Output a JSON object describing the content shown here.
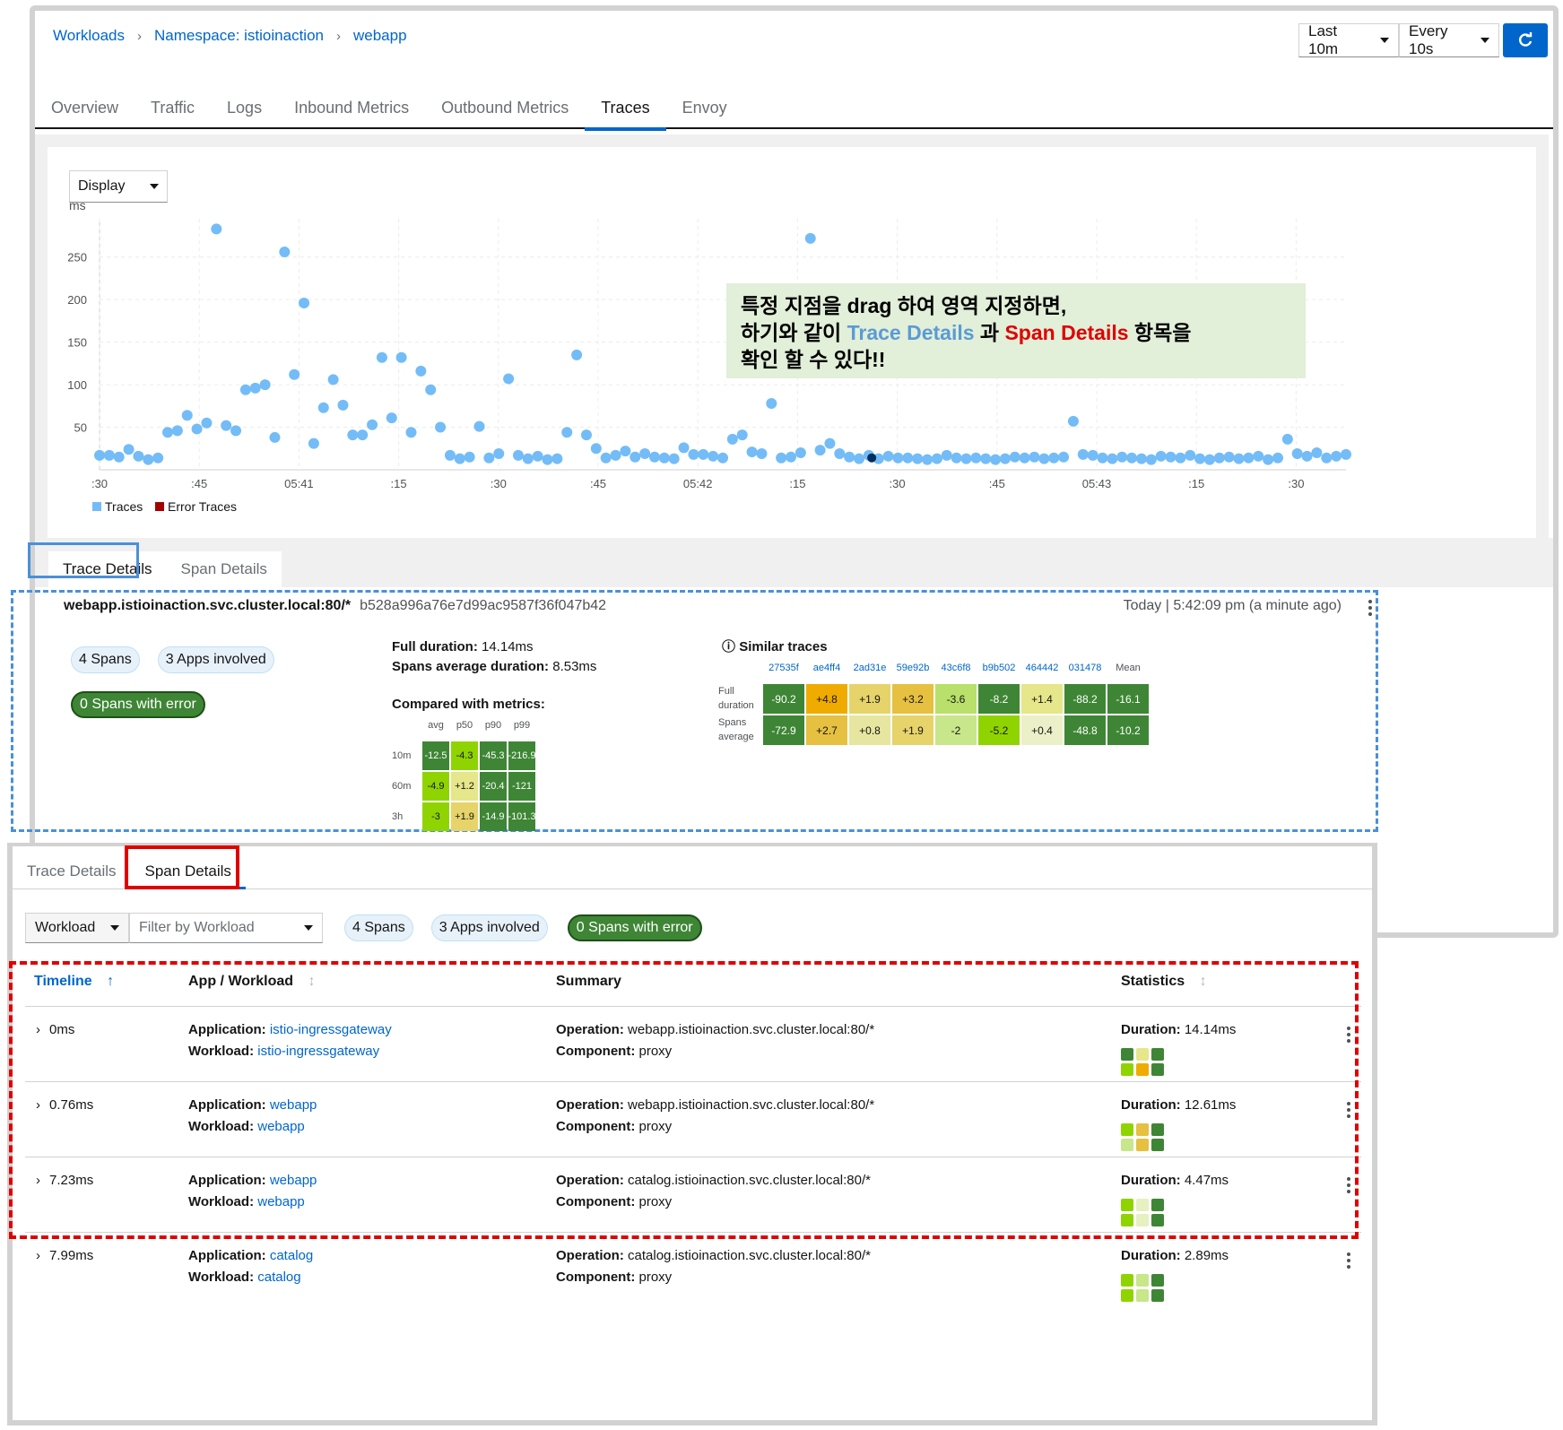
{
  "breadcrumb": [
    "Workloads",
    "Namespace: istioinaction",
    "webapp"
  ],
  "toolbar": {
    "range": "Last 10m",
    "refresh": "Every 10s"
  },
  "tabs": [
    "Overview",
    "Traffic",
    "Logs",
    "Inbound Metrics",
    "Outbound Metrics",
    "Traces",
    "Envoy"
  ],
  "active_tab": "Traces",
  "display_select": "Display",
  "annotation": {
    "line1": "특정 지점을 drag 하여 영역 지정하면,",
    "line2_a": "하기와 같이 ",
    "line2_trace": "Trace Details",
    "line2_b": " 과 ",
    "line2_span": "Span Details",
    "line2_c": " 항목을",
    "line3": "확인 할 수 있다!!"
  },
  "chart_data": {
    "type": "scatter",
    "ylabel": "ms",
    "y_ticks": [
      50,
      100,
      150,
      200,
      250
    ],
    "x_ticks": [
      ":30",
      ":45",
      "05:41",
      ":15",
      ":30",
      ":45",
      "05:42",
      ":15",
      ":30",
      ":45",
      "05:43",
      ":15",
      ":30"
    ],
    "legend": [
      "Traces",
      "Error Traces"
    ],
    "colors": {
      "traces": "#73bcf7",
      "error": "#a30000",
      "selected": "#002f5d"
    },
    "points_ms": [
      [
        0.0,
        17
      ],
      [
        0.1,
        17
      ],
      [
        0.2,
        15
      ],
      [
        0.3,
        24
      ],
      [
        0.4,
        16
      ],
      [
        0.5,
        12
      ],
      [
        0.6,
        14
      ],
      [
        0.7,
        44
      ],
      [
        0.8,
        46
      ],
      [
        0.9,
        64
      ],
      [
        1.0,
        48
      ],
      [
        1.1,
        55
      ],
      [
        1.2,
        283
      ],
      [
        1.3,
        52
      ],
      [
        1.4,
        46
      ],
      [
        1.5,
        94
      ],
      [
        1.6,
        96
      ],
      [
        1.7,
        100
      ],
      [
        1.8,
        38
      ],
      [
        1.9,
        256
      ],
      [
        2.0,
        112
      ],
      [
        2.1,
        196
      ],
      [
        2.2,
        31
      ],
      [
        2.3,
        73
      ],
      [
        2.4,
        106
      ],
      [
        2.5,
        76
      ],
      [
        2.6,
        41
      ],
      [
        2.7,
        41
      ],
      [
        2.8,
        53
      ],
      [
        2.9,
        132
      ],
      [
        3.0,
        61
      ],
      [
        3.1,
        132
      ],
      [
        3.2,
        44
      ],
      [
        3.3,
        116
      ],
      [
        3.4,
        94
      ],
      [
        3.5,
        50
      ],
      [
        3.6,
        17
      ],
      [
        3.7,
        13
      ],
      [
        3.8,
        15
      ],
      [
        3.9,
        51
      ],
      [
        4.0,
        14
      ],
      [
        4.1,
        19
      ],
      [
        4.2,
        107
      ],
      [
        4.3,
        17
      ],
      [
        4.4,
        13
      ],
      [
        4.5,
        16
      ],
      [
        4.6,
        12
      ],
      [
        4.7,
        13
      ],
      [
        4.8,
        44
      ],
      [
        4.9,
        135
      ],
      [
        5.0,
        41
      ],
      [
        5.1,
        25
      ],
      [
        5.2,
        14
      ],
      [
        5.3,
        17
      ],
      [
        5.4,
        22
      ],
      [
        5.5,
        15
      ],
      [
        5.6,
        19
      ],
      [
        5.7,
        15
      ],
      [
        5.8,
        14
      ],
      [
        5.9,
        13
      ],
      [
        6.0,
        26
      ],
      [
        6.1,
        18
      ],
      [
        6.2,
        18
      ],
      [
        6.3,
        16
      ],
      [
        6.4,
        14
      ],
      [
        6.5,
        36
      ],
      [
        6.6,
        41
      ],
      [
        6.7,
        21
      ],
      [
        6.8,
        19
      ],
      [
        6.9,
        78
      ],
      [
        7.0,
        14
      ],
      [
        7.1,
        15
      ],
      [
        7.2,
        20
      ],
      [
        7.3,
        272
      ],
      [
        7.4,
        23
      ],
      [
        7.5,
        31
      ],
      [
        7.6,
        19
      ],
      [
        7.7,
        15
      ],
      [
        7.8,
        13
      ],
      [
        7.9,
        17
      ],
      [
        8.0,
        13
      ],
      [
        8.1,
        16
      ],
      [
        8.2,
        14
      ],
      [
        8.3,
        14
      ],
      [
        8.4,
        13
      ],
      [
        8.5,
        12
      ],
      [
        8.6,
        13
      ],
      [
        8.7,
        17
      ],
      [
        8.8,
        14
      ],
      [
        8.9,
        13
      ],
      [
        9.0,
        14
      ],
      [
        9.1,
        13
      ],
      [
        9.2,
        12
      ],
      [
        9.3,
        13
      ],
      [
        9.4,
        15
      ],
      [
        9.5,
        14
      ],
      [
        9.6,
        15
      ],
      [
        9.7,
        13
      ],
      [
        9.8,
        14
      ],
      [
        9.9,
        15
      ],
      [
        10.0,
        57
      ],
      [
        10.1,
        18
      ],
      [
        10.2,
        17
      ],
      [
        10.3,
        14
      ],
      [
        10.4,
        13
      ],
      [
        10.5,
        15
      ],
      [
        10.6,
        14
      ],
      [
        10.7,
        13
      ],
      [
        10.8,
        12
      ],
      [
        10.9,
        16
      ],
      [
        11.0,
        15
      ],
      [
        11.1,
        14
      ],
      [
        11.2,
        17
      ],
      [
        11.3,
        13
      ],
      [
        11.4,
        12
      ],
      [
        11.5,
        14
      ],
      [
        11.6,
        15
      ],
      [
        11.7,
        13
      ],
      [
        11.8,
        14
      ],
      [
        11.9,
        16
      ],
      [
        12.0,
        12
      ],
      [
        12.1,
        14
      ],
      [
        12.2,
        36
      ],
      [
        12.3,
        19
      ],
      [
        12.4,
        16
      ],
      [
        12.5,
        20
      ],
      [
        12.6,
        14
      ],
      [
        12.7,
        16
      ],
      [
        12.8,
        18
      ]
    ],
    "selected_point": [
      7.93,
      14
    ]
  },
  "detail_tabs": [
    "Trace Details",
    "Span Details"
  ],
  "trace": {
    "id": "webapp.istioinaction.svc.cluster.local:80/*",
    "hash": "b528a996a76e7d99ac9587f36f047b42",
    "date": "Today | 5:42:09 pm (a minute ago)",
    "spans_pill": "4 Spans",
    "apps_pill": "3 Apps involved",
    "error_pill": "0 Spans with error",
    "full_duration_label": "Full duration:",
    "full_duration": "14.14ms",
    "avg_duration_label": "Spans average duration:",
    "avg_duration": "8.53ms",
    "compared_title": "Compared with metrics:",
    "metric_cols": [
      "avg",
      "p50",
      "p90",
      "p99"
    ],
    "metric_rows": [
      {
        "label": "10m",
        "values": [
          "-12.5",
          "-4.3",
          "-45.3",
          "-216.9"
        ],
        "colors": [
          "#3e8635",
          "#8fd400",
          "#3e8635",
          "#3e8635"
        ]
      },
      {
        "label": "60m",
        "values": [
          "-4.9",
          "+1.2",
          "-20.4",
          "-121"
        ],
        "colors": [
          "#8fd400",
          "#e6e68a",
          "#3e8635",
          "#3e8635"
        ]
      },
      {
        "label": "3h",
        "values": [
          "-3",
          "+1.9",
          "-14.9",
          "-101.3"
        ],
        "colors": [
          "#8fd400",
          "#e6d36a",
          "#3e8635",
          "#3e8635"
        ]
      }
    ],
    "similar_title": "Similar traces",
    "similar_cols": [
      "27535f",
      "ae4ff4",
      "2ad31e",
      "59e92b",
      "43c6f8",
      "b9b502",
      "464442",
      "031478",
      "Mean"
    ],
    "similar_rows": [
      {
        "label1": "Full",
        "label2": "duration",
        "values": [
          "-90.2",
          "+4.8",
          "+1.9",
          "+3.2",
          "-3.6",
          "-8.2",
          "+1.4",
          "-88.2",
          "-16.1"
        ],
        "colors": [
          "#3e8635",
          "#f0ab00",
          "#e6d36a",
          "#e6c040",
          "#b8e06a",
          "#3e8635",
          "#e6e68a",
          "#3e8635",
          "#3e8635"
        ]
      },
      {
        "label1": "Spans",
        "label2": "average",
        "values": [
          "-72.9",
          "+2.7",
          "+0.8",
          "+1.9",
          "-2",
          "-5.2",
          "+0.4",
          "-48.8",
          "-10.2"
        ],
        "colors": [
          "#3e8635",
          "#e6c040",
          "#e6e6a0",
          "#e6d36a",
          "#c8e68a",
          "#8fd400",
          "#ecf0c8",
          "#3e8635",
          "#3e8635"
        ]
      }
    ]
  },
  "span_tab_active": "Span Details",
  "filter": {
    "type": "Workload",
    "placeholder": "Filter by Workload",
    "spans": "4 Spans",
    "apps": "3 Apps involved",
    "errors": "0 Spans with error"
  },
  "table": {
    "headers": [
      "Timeline",
      "App / Workload",
      "Summary",
      "Statistics"
    ],
    "app_label": "Application:",
    "workload_label": "Workload:",
    "operation_label": "Operation:",
    "component_label": "Component:",
    "duration_label": "Duration:",
    "rows": [
      {
        "time": "0ms",
        "app": "istio-ingressgateway",
        "workload": "istio-ingressgateway",
        "operation": "webapp.istioinaction.svc.cluster.local:80/*",
        "component": "proxy",
        "duration": "14.14ms",
        "mini": [
          "#3e8635",
          "#e6e68a",
          "#3e8635",
          "#8fd400",
          "#f0ab00",
          "#3e8635"
        ]
      },
      {
        "time": "0.76ms",
        "app": "webapp",
        "workload": "webapp",
        "operation": "webapp.istioinaction.svc.cluster.local:80/*",
        "component": "proxy",
        "duration": "12.61ms",
        "mini": [
          "#8fd400",
          "#e6c040",
          "#3e8635",
          "#c8e68a",
          "#e6c040",
          "#3e8635"
        ]
      },
      {
        "time": "7.23ms",
        "app": "webapp",
        "workload": "webapp",
        "operation": "catalog.istioinaction.svc.cluster.local:80/*",
        "component": "proxy",
        "duration": "4.47ms",
        "mini": [
          "#8fd400",
          "#e6f0c0",
          "#3e8635",
          "#8fd400",
          "#e6f0c0",
          "#3e8635"
        ]
      },
      {
        "time": "7.99ms",
        "app": "catalog",
        "workload": "catalog",
        "operation": "catalog.istioinaction.svc.cluster.local:80/*",
        "component": "proxy",
        "duration": "2.89ms",
        "mini": [
          "#8fd400",
          "#c8e68a",
          "#3e8635",
          "#8fd400",
          "#c8e68a",
          "#3e8635"
        ]
      }
    ]
  }
}
